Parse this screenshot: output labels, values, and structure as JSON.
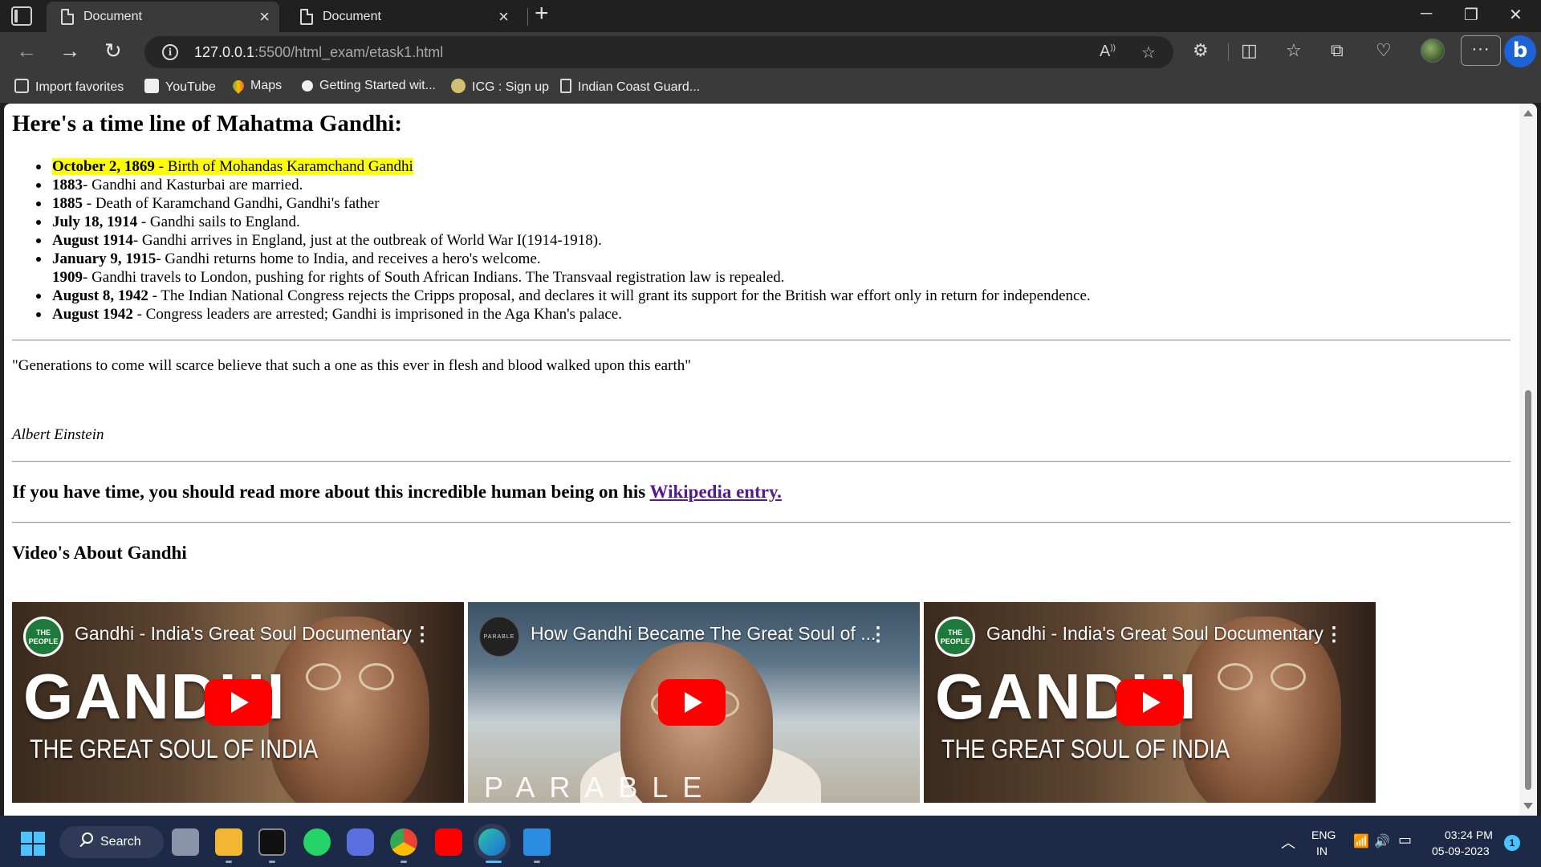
{
  "browser": {
    "tabs": [
      {
        "title": "Document",
        "active": true
      },
      {
        "title": "Document",
        "active": false
      }
    ],
    "url_host": "127.0.0.1",
    "url_rest": ":5500/html_exam/etask1.html",
    "favorites": [
      {
        "label": "Import favorites",
        "icon": "import-icon"
      },
      {
        "label": "YouTube",
        "icon": "youtube-icon"
      },
      {
        "label": "Maps",
        "icon": "maps-icon"
      },
      {
        "label": "Getting Started wit...",
        "icon": "medium-icon"
      },
      {
        "label": "ICG : Sign up",
        "icon": "icg-icon"
      },
      {
        "label": "Indian Coast Guard...",
        "icon": "document-icon"
      }
    ],
    "more_label": "···",
    "bing_label": "b"
  },
  "page": {
    "heading": "Here's a time line of Mahatma Gandhi:",
    "timeline": [
      {
        "date": "October 2, 1869",
        "text": " - Birth of Mohandas Karamchand Gandhi",
        "highlight": true,
        "bullet": true
      },
      {
        "date": "1883",
        "text": "- Gandhi and Kasturbai are married.",
        "highlight": false,
        "bullet": true
      },
      {
        "date": "1885",
        "text": " - Death of Karamchand Gandhi, Gandhi's father",
        "highlight": false,
        "bullet": true
      },
      {
        "date": "July 18, 1914",
        "text": " - Gandhi sails to England.",
        "highlight": false,
        "bullet": true
      },
      {
        "date": "August 1914",
        "text": "- Gandhi arrives in England, just at the outbreak of World War I(1914-1918).",
        "highlight": false,
        "bullet": true
      },
      {
        "date": "January 9, 1915",
        "text": "- Gandhi returns home to India, and receives a hero's welcome.",
        "highlight": false,
        "bullet": true
      },
      {
        "date": "1909",
        "text": "- Gandhi travels to London, pushing for rights of South African Indians. The Transvaal registration law is repealed.",
        "highlight": false,
        "bullet": false
      },
      {
        "date": "August 8, 1942",
        "text": " - The Indian National Congress rejects the Cripps proposal, and declares it will grant its support for the British war effort only in return for independence.",
        "highlight": false,
        "bullet": true
      },
      {
        "date": "August 1942",
        "text": " - Congress leaders are arrested; Gandhi is imprisoned in the Aga Khan's palace.",
        "highlight": false,
        "bullet": true
      }
    ],
    "quote": "\"Generations to come will scarce believe that such a one as this ever in flesh and blood walked upon this earth\"",
    "author": "Albert Einstein",
    "readmore_text": "If you have time, you should read more about this incredible human being on his ",
    "readmore_link": "Wikipedia entry.",
    "videos_heading": "Video's About Gandhi",
    "videos": [
      {
        "title": "Gandhi - India's Great Soul Documentary",
        "channel": "THE PEOPLE PROFILES",
        "big": "GANDHI",
        "sub": "THE GREAT SOUL OF INDIA"
      },
      {
        "title": "How Gandhi Became The Great Soul of ...",
        "channel": "PARABLE",
        "big": "PARABLE",
        "sub": ""
      },
      {
        "title": "Gandhi - India's Great Soul Documentary",
        "channel": "THE PEOPLE PROFILES",
        "big": "GANDHI",
        "sub": "THE GREAT SOUL OF INDIA"
      }
    ]
  },
  "taskbar": {
    "search_label": "Search",
    "lang_top": "ENG",
    "lang_bottom": "IN",
    "time": "03:24 PM",
    "date": "05-09-2023",
    "notifications": "1"
  },
  "colors": {
    "highlight": "#ffff00",
    "visited_link": "#551a8b",
    "youtube_red": "#ff0000",
    "taskbar_bg": "#1c2a48"
  }
}
